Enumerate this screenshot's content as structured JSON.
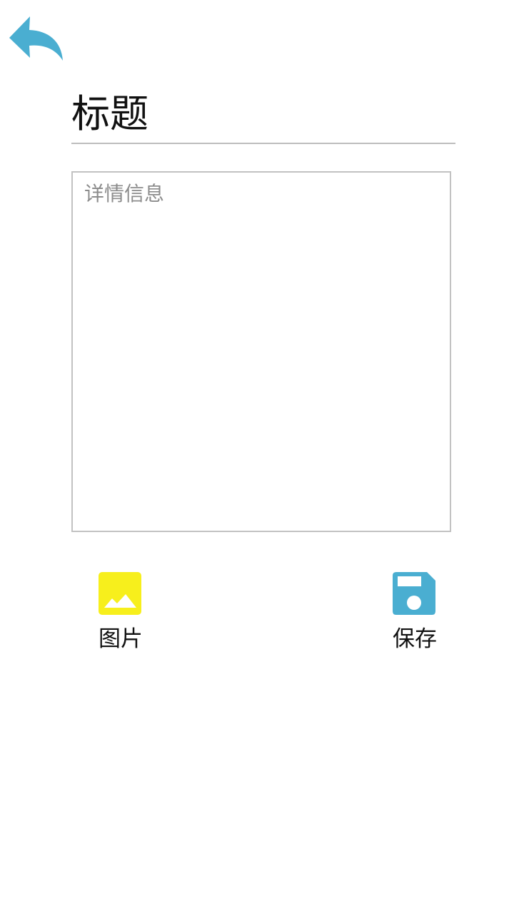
{
  "header": {
    "back_icon": "back-arrow-icon",
    "back_color": "#4aaed1"
  },
  "form": {
    "title_placeholder": "标题",
    "details_placeholder": "详情信息"
  },
  "actions": {
    "image": {
      "label": "图片",
      "icon": "image-icon",
      "color": "#f7ef1c"
    },
    "save": {
      "label": "保存",
      "icon": "floppy-disk-icon",
      "color": "#4aaed1"
    }
  }
}
